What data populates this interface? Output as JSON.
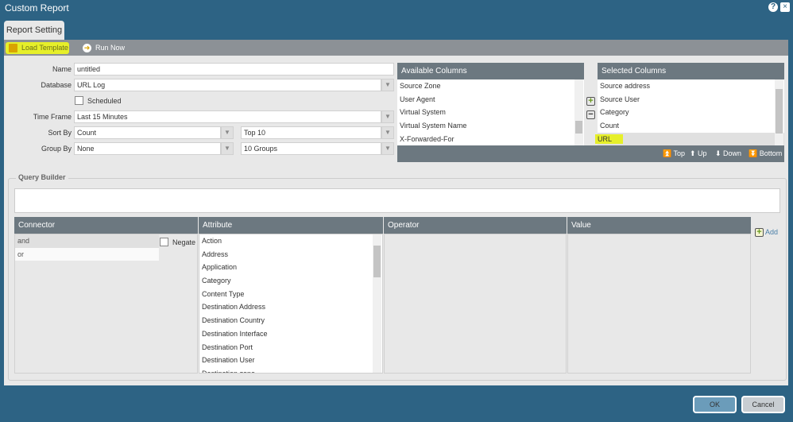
{
  "window": {
    "title": "Custom Report",
    "help": "?",
    "close": "×"
  },
  "tabs": [
    {
      "label": "Report Setting"
    }
  ],
  "toolbar": {
    "load_template": "Load Template",
    "run_now": "Run Now"
  },
  "form": {
    "name_label": "Name",
    "name_value": "untitled",
    "database_label": "Database",
    "database_value": "URL Log",
    "scheduled_label": "Scheduled",
    "timeframe_label": "Time Frame",
    "timeframe_value": "Last 15 Minutes",
    "sortby_label": "Sort By",
    "sortby_value": "Count",
    "sortby_top": "Top 10",
    "groupby_label": "Group By",
    "groupby_value": "None",
    "groupby_count": "10 Groups"
  },
  "available": {
    "header": "Available Columns",
    "items": [
      "Source Zone",
      "User Agent",
      "Virtual System",
      "Virtual System Name",
      "X-Forwarded-For"
    ]
  },
  "selected": {
    "header": "Selected Columns",
    "items": [
      "Source address",
      "Source User",
      "Category",
      "Count",
      "URL"
    ],
    "selected_item": "URL"
  },
  "order_buttons": {
    "top": "Top",
    "up": "Up",
    "down": "Down",
    "bottom": "Bottom"
  },
  "query": {
    "legend": "Query Builder",
    "columns": [
      "Connector",
      "Attribute",
      "Operator",
      "Value"
    ],
    "connectors": [
      "and",
      "or"
    ],
    "negate": "Negate",
    "attributes": [
      "Action",
      "Address",
      "Application",
      "Category",
      "Content Type",
      "Destination Address",
      "Destination Country",
      "Destination Interface",
      "Destination Port",
      "Destination User",
      "Destination zone"
    ],
    "add": "Add"
  },
  "footer": {
    "ok": "OK",
    "cancel": "Cancel"
  },
  "colors": {
    "title_bar": "#2d6384",
    "highlight": "#e6ef2a",
    "header": "#6c7880"
  }
}
